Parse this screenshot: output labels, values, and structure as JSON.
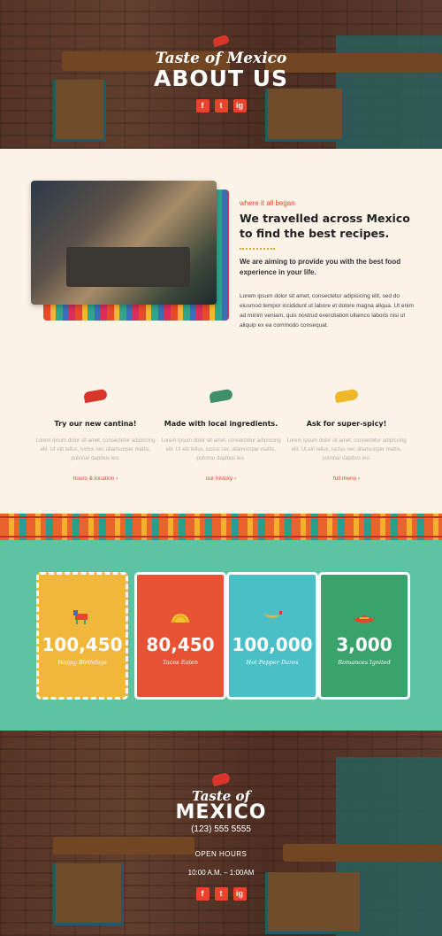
{
  "hero": {
    "script_title": "Taste of Mexico",
    "title": "ABOUT US",
    "social": [
      "f",
      "t",
      "ig"
    ]
  },
  "about": {
    "eyebrow": "where it all began",
    "heading_line1": "We travelled across Mexico",
    "heading_line2": "to find the best recipes.",
    "lead": "We are aiming to provide you with the best food experience in your life.",
    "body": "Lorem ipsum dolor sit amet, consectetur adipisicing elit, sed do eiusmod tempor incididunt ut labore et dolore magna aliqua. Ut enim ad minim veniam, quis nostrud exercitation ullamco laboris nisi ut aliquip ex ea commodo consequat."
  },
  "features": [
    {
      "title": "Try our new cantina!",
      "body": "Lorem ipsum dolor sit amet, consectetur adipiscing elit. Ut elit tellus, luctus nec ullamcorper mattis, pulvinar dapibus leo.",
      "link": "hours & location",
      "color": "#d9362b"
    },
    {
      "title": "Made with local ingredients.",
      "body": "Lorem ipsum dolor sit amet, consectetur adipiscing elit. Ut elit tellus, luctus nec ullamcorper mattis, pulvinar dapibus leo.",
      "link": "our history",
      "color": "#3f8f6b"
    },
    {
      "title": "Ask for super-spicy!",
      "body": "Lorem ipsum dolor sit amet, consectetur adipiscing elit. Ut elit tellus, luctus nec ullamcorper mattis, pulvinar dapibus leo.",
      "link": "full menu",
      "color": "#f0b72b"
    }
  ],
  "stats": [
    {
      "number": "100,450",
      "label": "Happy Birthdays",
      "color": "#f1b73a",
      "icon": "pinata-icon"
    },
    {
      "number": "80,450",
      "label": "Tacos Eaten",
      "color": "#e85234",
      "icon": "taco-icon"
    },
    {
      "number": "100,000",
      "label": "Hot Pepper Dares",
      "color": "#4bbfc8",
      "icon": "pepper-icon"
    },
    {
      "number": "3,000",
      "label": "Romances Ignited",
      "color": "#3aa36d",
      "icon": "sombrero-icon"
    }
  ],
  "footer": {
    "script_title": "Taste of",
    "title": "MEXICO",
    "phone": "(123) 555 5555",
    "hours_label": "OPEN HOURS",
    "hours": "10:00 A.M. – 1:00AM",
    "social": [
      "f",
      "t",
      "ig"
    ]
  }
}
